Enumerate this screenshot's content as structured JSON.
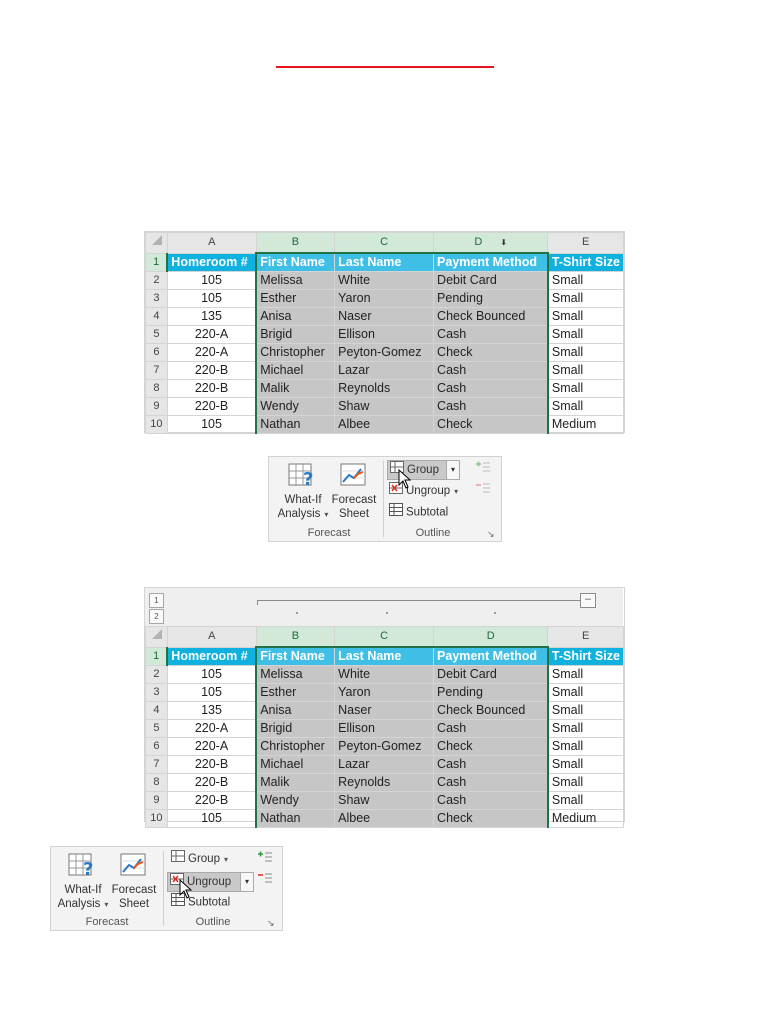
{
  "colors": {
    "header_fill": "#10b0df",
    "selection_fill": "#c6c6c6",
    "accent_green": "#217346",
    "rule_red": "#e8141b"
  },
  "sheet": {
    "columns": [
      "A",
      "B",
      "C",
      "D",
      "E"
    ],
    "rows": [
      "1",
      "2",
      "3",
      "4",
      "5",
      "6",
      "7",
      "8",
      "9",
      "10"
    ],
    "headers": [
      "Homeroom #",
      "First Name",
      "Last Name",
      "Payment Method",
      "T-Shirt Size"
    ],
    "data": [
      [
        "105",
        "Melissa",
        "White",
        "Debit Card",
        "Small"
      ],
      [
        "105",
        "Esther",
        "Yaron",
        "Pending",
        "Small"
      ],
      [
        "135",
        "Anisa",
        "Naser",
        "Check Bounced",
        "Small"
      ],
      [
        "220-A",
        "Brigid",
        "Ellison",
        "Cash",
        "Small"
      ],
      [
        "220-A",
        "Christopher",
        "Peyton-Gomez",
        "Check",
        "Small"
      ],
      [
        "220-B",
        "Michael",
        "Lazar",
        "Cash",
        "Small"
      ],
      [
        "220-B",
        "Malik",
        "Reynolds",
        "Cash",
        "Small"
      ],
      [
        "220-B",
        "Wendy",
        "Shaw",
        "Cash",
        "Small"
      ],
      [
        "105",
        "Nathan",
        "Albee",
        "Check",
        "Medium"
      ]
    ]
  },
  "outline_bar": {
    "levels": [
      "1",
      "2"
    ],
    "collapse_symbol": "–"
  },
  "ribbon": {
    "what_if_line1": "What-If",
    "what_if_line2": "Analysis",
    "forecast_line1": "Forecast",
    "forecast_line2": "Sheet",
    "forecast_group": "Forecast",
    "group_label": "Group",
    "ungroup_label": "Ungroup",
    "subtotal_label": "Subtotal",
    "outline_group": "Outline"
  }
}
